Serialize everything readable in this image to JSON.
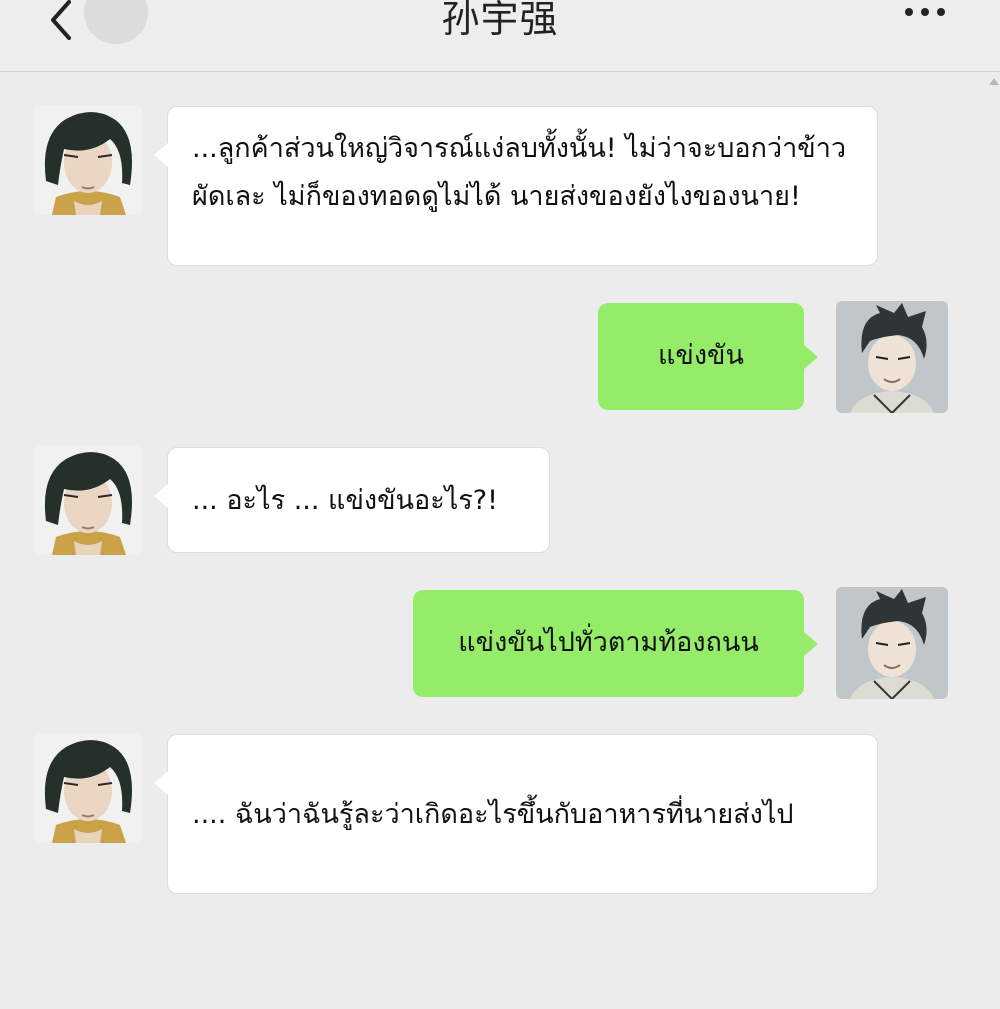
{
  "header": {
    "title": "孙宇强"
  },
  "messages": [
    {
      "direction": "incoming",
      "text": "...ลูกค้าส่วนใหญ่วิจารณ์แง่ลบทั้งนั้น! ไม่ว่าจะบอกว่าข้าวผัดเละ ไม่ก็ของทอดดูไม่ได้ นายส่งของยังไงของนาย!"
    },
    {
      "direction": "outgoing",
      "text": "แข่งขัน"
    },
    {
      "direction": "incoming",
      "text": "... อะไร ... แข่งขันอะไร?!"
    },
    {
      "direction": "outgoing",
      "text": "แข่งขันไปทั่วตามท้องถนน"
    },
    {
      "direction": "incoming",
      "text": ".... ฉันว่าฉันรู้ละว่าเกิดอะไรขึ้นกับอาหารที่นายส่งไป"
    }
  ],
  "colors": {
    "outgoing_bubble": "#95ec69",
    "incoming_bubble": "#ffffff",
    "background": "#ececec"
  }
}
